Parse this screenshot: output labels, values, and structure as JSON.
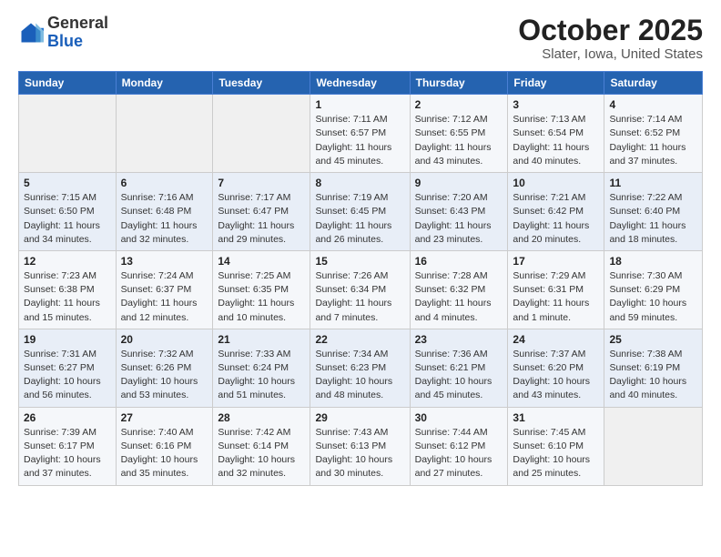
{
  "header": {
    "logo_line1": "General",
    "logo_line2": "Blue",
    "title": "October 2025",
    "subtitle": "Slater, Iowa, United States"
  },
  "days_of_week": [
    "Sunday",
    "Monday",
    "Tuesday",
    "Wednesday",
    "Thursday",
    "Friday",
    "Saturday"
  ],
  "weeks": [
    [
      {
        "day": "",
        "info": ""
      },
      {
        "day": "",
        "info": ""
      },
      {
        "day": "",
        "info": ""
      },
      {
        "day": "1",
        "info": "Sunrise: 7:11 AM\nSunset: 6:57 PM\nDaylight: 11 hours and 45 minutes."
      },
      {
        "day": "2",
        "info": "Sunrise: 7:12 AM\nSunset: 6:55 PM\nDaylight: 11 hours and 43 minutes."
      },
      {
        "day": "3",
        "info": "Sunrise: 7:13 AM\nSunset: 6:54 PM\nDaylight: 11 hours and 40 minutes."
      },
      {
        "day": "4",
        "info": "Sunrise: 7:14 AM\nSunset: 6:52 PM\nDaylight: 11 hours and 37 minutes."
      }
    ],
    [
      {
        "day": "5",
        "info": "Sunrise: 7:15 AM\nSunset: 6:50 PM\nDaylight: 11 hours and 34 minutes."
      },
      {
        "day": "6",
        "info": "Sunrise: 7:16 AM\nSunset: 6:48 PM\nDaylight: 11 hours and 32 minutes."
      },
      {
        "day": "7",
        "info": "Sunrise: 7:17 AM\nSunset: 6:47 PM\nDaylight: 11 hours and 29 minutes."
      },
      {
        "day": "8",
        "info": "Sunrise: 7:19 AM\nSunset: 6:45 PM\nDaylight: 11 hours and 26 minutes."
      },
      {
        "day": "9",
        "info": "Sunrise: 7:20 AM\nSunset: 6:43 PM\nDaylight: 11 hours and 23 minutes."
      },
      {
        "day": "10",
        "info": "Sunrise: 7:21 AM\nSunset: 6:42 PM\nDaylight: 11 hours and 20 minutes."
      },
      {
        "day": "11",
        "info": "Sunrise: 7:22 AM\nSunset: 6:40 PM\nDaylight: 11 hours and 18 minutes."
      }
    ],
    [
      {
        "day": "12",
        "info": "Sunrise: 7:23 AM\nSunset: 6:38 PM\nDaylight: 11 hours and 15 minutes."
      },
      {
        "day": "13",
        "info": "Sunrise: 7:24 AM\nSunset: 6:37 PM\nDaylight: 11 hours and 12 minutes."
      },
      {
        "day": "14",
        "info": "Sunrise: 7:25 AM\nSunset: 6:35 PM\nDaylight: 11 hours and 10 minutes."
      },
      {
        "day": "15",
        "info": "Sunrise: 7:26 AM\nSunset: 6:34 PM\nDaylight: 11 hours and 7 minutes."
      },
      {
        "day": "16",
        "info": "Sunrise: 7:28 AM\nSunset: 6:32 PM\nDaylight: 11 hours and 4 minutes."
      },
      {
        "day": "17",
        "info": "Sunrise: 7:29 AM\nSunset: 6:31 PM\nDaylight: 11 hours and 1 minute."
      },
      {
        "day": "18",
        "info": "Sunrise: 7:30 AM\nSunset: 6:29 PM\nDaylight: 10 hours and 59 minutes."
      }
    ],
    [
      {
        "day": "19",
        "info": "Sunrise: 7:31 AM\nSunset: 6:27 PM\nDaylight: 10 hours and 56 minutes."
      },
      {
        "day": "20",
        "info": "Sunrise: 7:32 AM\nSunset: 6:26 PM\nDaylight: 10 hours and 53 minutes."
      },
      {
        "day": "21",
        "info": "Sunrise: 7:33 AM\nSunset: 6:24 PM\nDaylight: 10 hours and 51 minutes."
      },
      {
        "day": "22",
        "info": "Sunrise: 7:34 AM\nSunset: 6:23 PM\nDaylight: 10 hours and 48 minutes."
      },
      {
        "day": "23",
        "info": "Sunrise: 7:36 AM\nSunset: 6:21 PM\nDaylight: 10 hours and 45 minutes."
      },
      {
        "day": "24",
        "info": "Sunrise: 7:37 AM\nSunset: 6:20 PM\nDaylight: 10 hours and 43 minutes."
      },
      {
        "day": "25",
        "info": "Sunrise: 7:38 AM\nSunset: 6:19 PM\nDaylight: 10 hours and 40 minutes."
      }
    ],
    [
      {
        "day": "26",
        "info": "Sunrise: 7:39 AM\nSunset: 6:17 PM\nDaylight: 10 hours and 37 minutes."
      },
      {
        "day": "27",
        "info": "Sunrise: 7:40 AM\nSunset: 6:16 PM\nDaylight: 10 hours and 35 minutes."
      },
      {
        "day": "28",
        "info": "Sunrise: 7:42 AM\nSunset: 6:14 PM\nDaylight: 10 hours and 32 minutes."
      },
      {
        "day": "29",
        "info": "Sunrise: 7:43 AM\nSunset: 6:13 PM\nDaylight: 10 hours and 30 minutes."
      },
      {
        "day": "30",
        "info": "Sunrise: 7:44 AM\nSunset: 6:12 PM\nDaylight: 10 hours and 27 minutes."
      },
      {
        "day": "31",
        "info": "Sunrise: 7:45 AM\nSunset: 6:10 PM\nDaylight: 10 hours and 25 minutes."
      },
      {
        "day": "",
        "info": ""
      }
    ]
  ]
}
